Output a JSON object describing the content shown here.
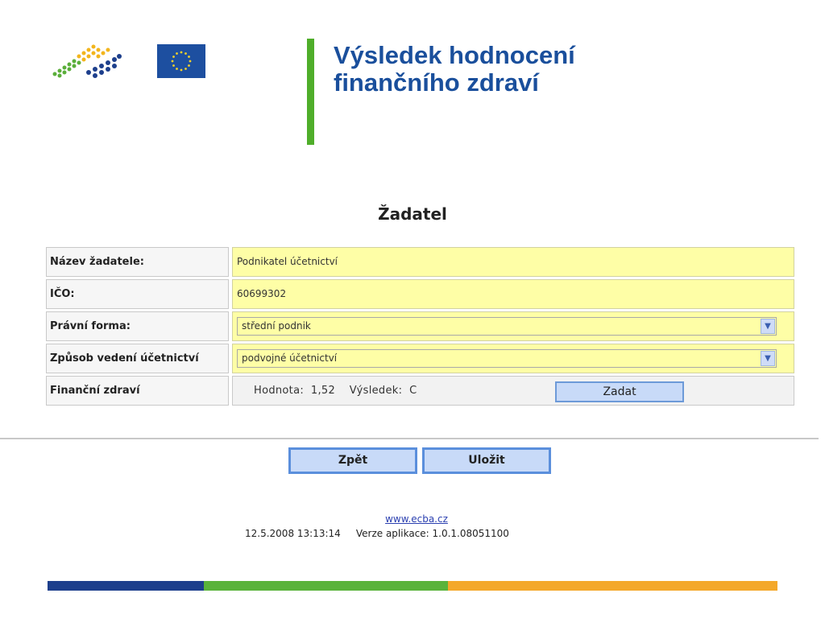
{
  "header": {
    "title_line1": "Výsledek hodnocení",
    "title_line2": "finančního zdraví"
  },
  "form": {
    "heading": "Žadatel",
    "rows": [
      {
        "label": "Název žadatele:",
        "value": "Podnikatel účetnictví"
      },
      {
        "label": "IČO:",
        "value": "60699302"
      },
      {
        "label": "Právní forma:",
        "value": "střední podnik"
      },
      {
        "label": "Způsob vedení účetnictví",
        "value": "podvojné účetnictví"
      },
      {
        "label": "Finanční zdraví",
        "hodnota_label": "Hodnota:",
        "hodnota_value": "1,52",
        "vysledek_label": "Výsledek:",
        "vysledek_value": "C",
        "button": "Zadat"
      }
    ]
  },
  "actions": {
    "back": "Zpět",
    "save": "Uložit"
  },
  "footer": {
    "link": "www.ecba.cz",
    "timestamp": "12.5.2008 13:13:14",
    "version_label": "Verze aplikace: 1.0.1.08051100"
  },
  "colors": {
    "title": "#1a4f9c",
    "accent_bar": "#4fae2a",
    "field_bg": "#fefea6",
    "button_bg": "#c8daf8",
    "stripe_blue": "#1d3f8c",
    "stripe_green": "#59b33a",
    "stripe_orange": "#f4a82a"
  }
}
